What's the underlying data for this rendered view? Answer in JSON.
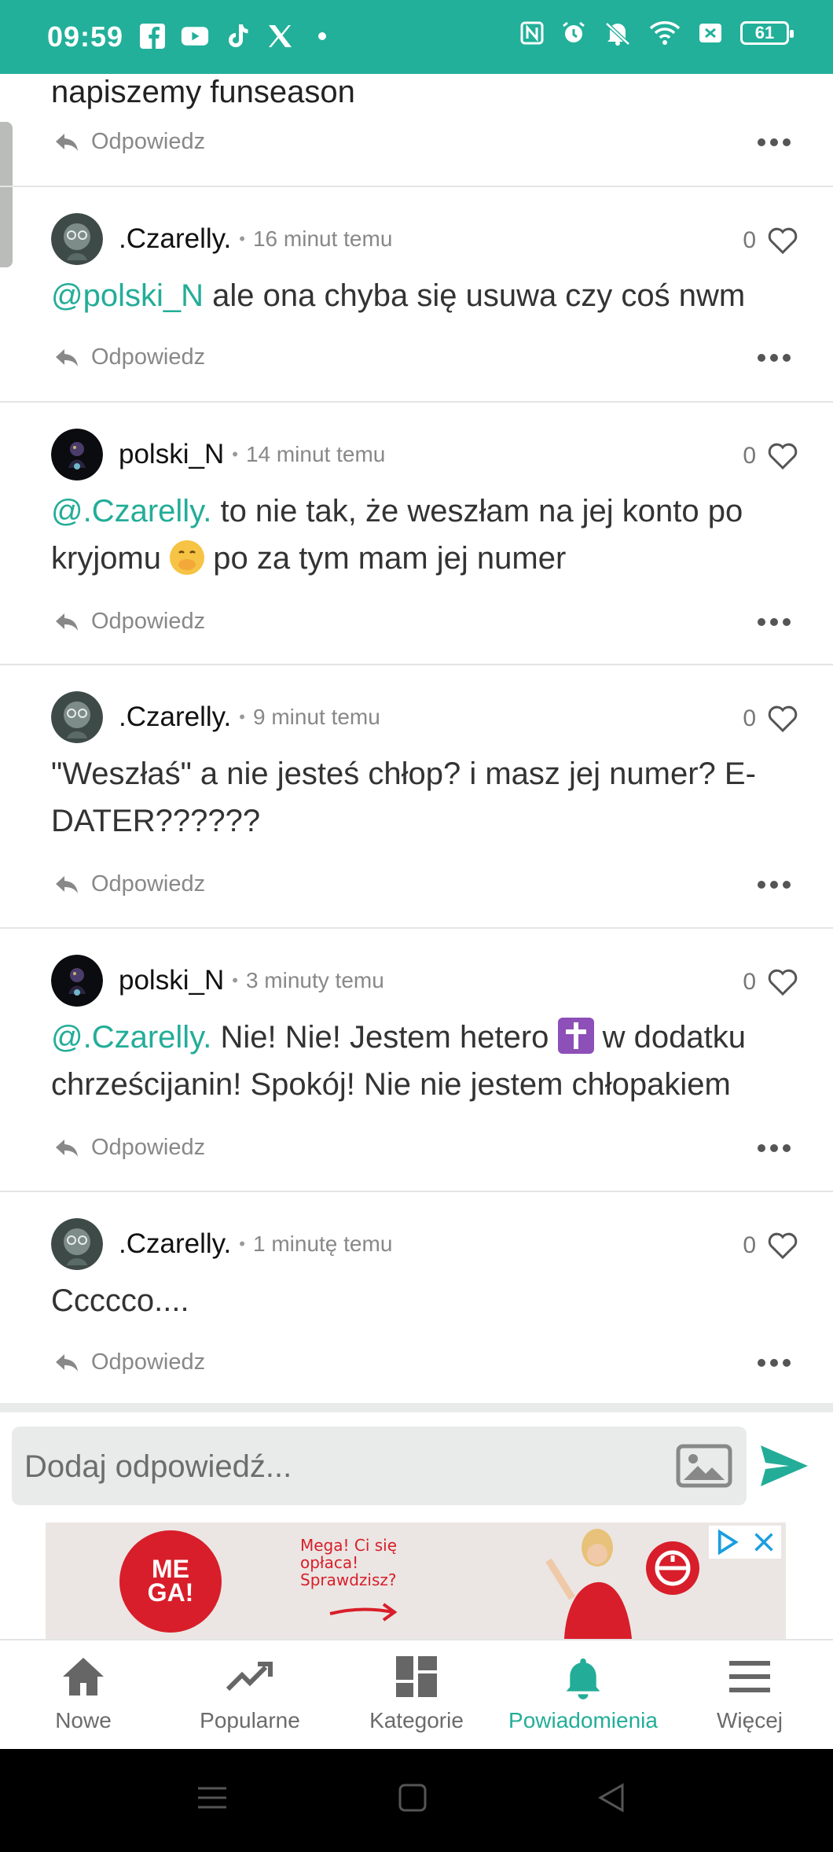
{
  "status_bar": {
    "time": "09:59",
    "battery": "61",
    "left_icons": [
      "facebook-icon",
      "youtube-icon",
      "tiktok-icon",
      "x-icon",
      "dot-icon"
    ],
    "right_icons": [
      "nfc-icon",
      "alarm-icon",
      "mute-icon",
      "wifi-icon",
      "sim-icon",
      "battery-icon"
    ]
  },
  "colors": {
    "accent": "#22b09a",
    "mention": "#23ad98"
  },
  "partial_comment": {
    "text": "napiszemy funseason",
    "reply_label": "Odpowiedz"
  },
  "comments": [
    {
      "username": ".Czarelly.",
      "time": "16 minut temu",
      "likes": "0",
      "mention": "@polski_N",
      "text": " ale ona chyba się usuwa czy coś nwm",
      "reply_label": "Odpowiedz"
    },
    {
      "username": "polski_N",
      "time": "14 minut temu",
      "likes": "0",
      "mention": "@.Czarelly.",
      "text_before_emoji": " to nie tak, że weszłam na jej konto po kryjomu ",
      "emoji": "face-with-hand-over-mouth",
      "text_after_emoji": " po za tym mam jej numer",
      "reply_label": "Odpowiedz"
    },
    {
      "username": ".Czarelly.",
      "time": "9 minut temu",
      "likes": "0",
      "text": "\"Weszłaś\" a nie jesteś chłop? i masz jej numer? E-DATER??????",
      "reply_label": "Odpowiedz"
    },
    {
      "username": "polski_N",
      "time": "3 minuty temu",
      "likes": "0",
      "mention": "@.Czarelly.",
      "text_before_emoji": " Nie! Nie! Jestem hetero ",
      "emoji": "latin-cross",
      "text_after_emoji": " w dodatku chrześcijanin! Spokój! Nie nie jestem chłopakiem",
      "reply_label": "Odpowiedz"
    },
    {
      "username": ".Czarelly.",
      "time": "1 minutę temu",
      "likes": "0",
      "text": "Ccccco....",
      "reply_label": "Odpowiedz"
    }
  ],
  "reply_input": {
    "placeholder": "Dodaj odpowiedź..."
  },
  "ad": {
    "logo_line1": "ME",
    "logo_line2": "GA!",
    "line1": "Mega! Ci się",
    "line2": "opłaca!",
    "line3": "Sprawdzisz?"
  },
  "bottom_nav": [
    {
      "label": "Nowe",
      "icon": "home-icon",
      "active": false
    },
    {
      "label": "Popularne",
      "icon": "trending-icon",
      "active": false
    },
    {
      "label": "Kategorie",
      "icon": "categories-icon",
      "active": false
    },
    {
      "label": "Powiadomienia",
      "icon": "bell-icon",
      "active": true
    },
    {
      "label": "Więcej",
      "icon": "menu-icon",
      "active": false
    }
  ]
}
